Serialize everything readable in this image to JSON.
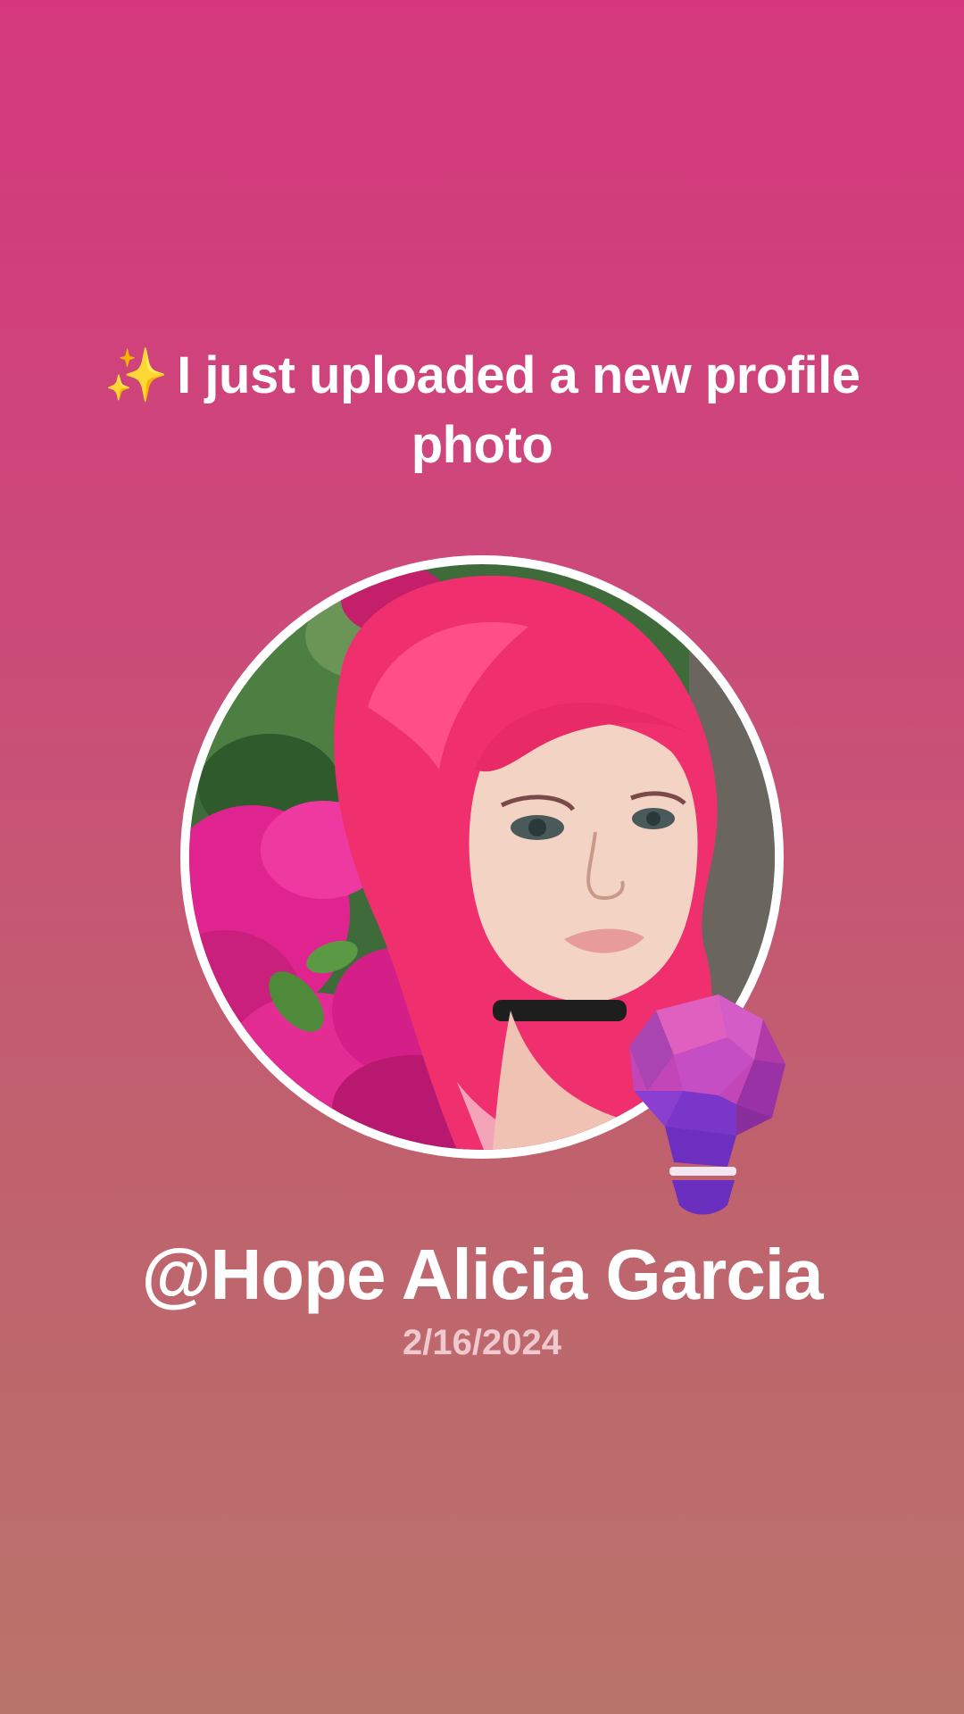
{
  "headline": {
    "sparkle": "✨",
    "text": "I just uploaded a new profile photo"
  },
  "profile": {
    "username": "@Hope Alicia Garcia",
    "date": "2/16/2024"
  },
  "colors": {
    "background_top": "#d4377d",
    "background_bottom": "#b9746a",
    "text": "#ffffff",
    "date_text": "#f0c9cf",
    "avatar_border": "#ffffff",
    "hair": "#f0306e",
    "bulb_purple": "#8b3fd0",
    "bulb_pink": "#e552b4"
  },
  "icons": {
    "sparkle": "sparkles-icon",
    "badge": "lightbulb-icon"
  }
}
